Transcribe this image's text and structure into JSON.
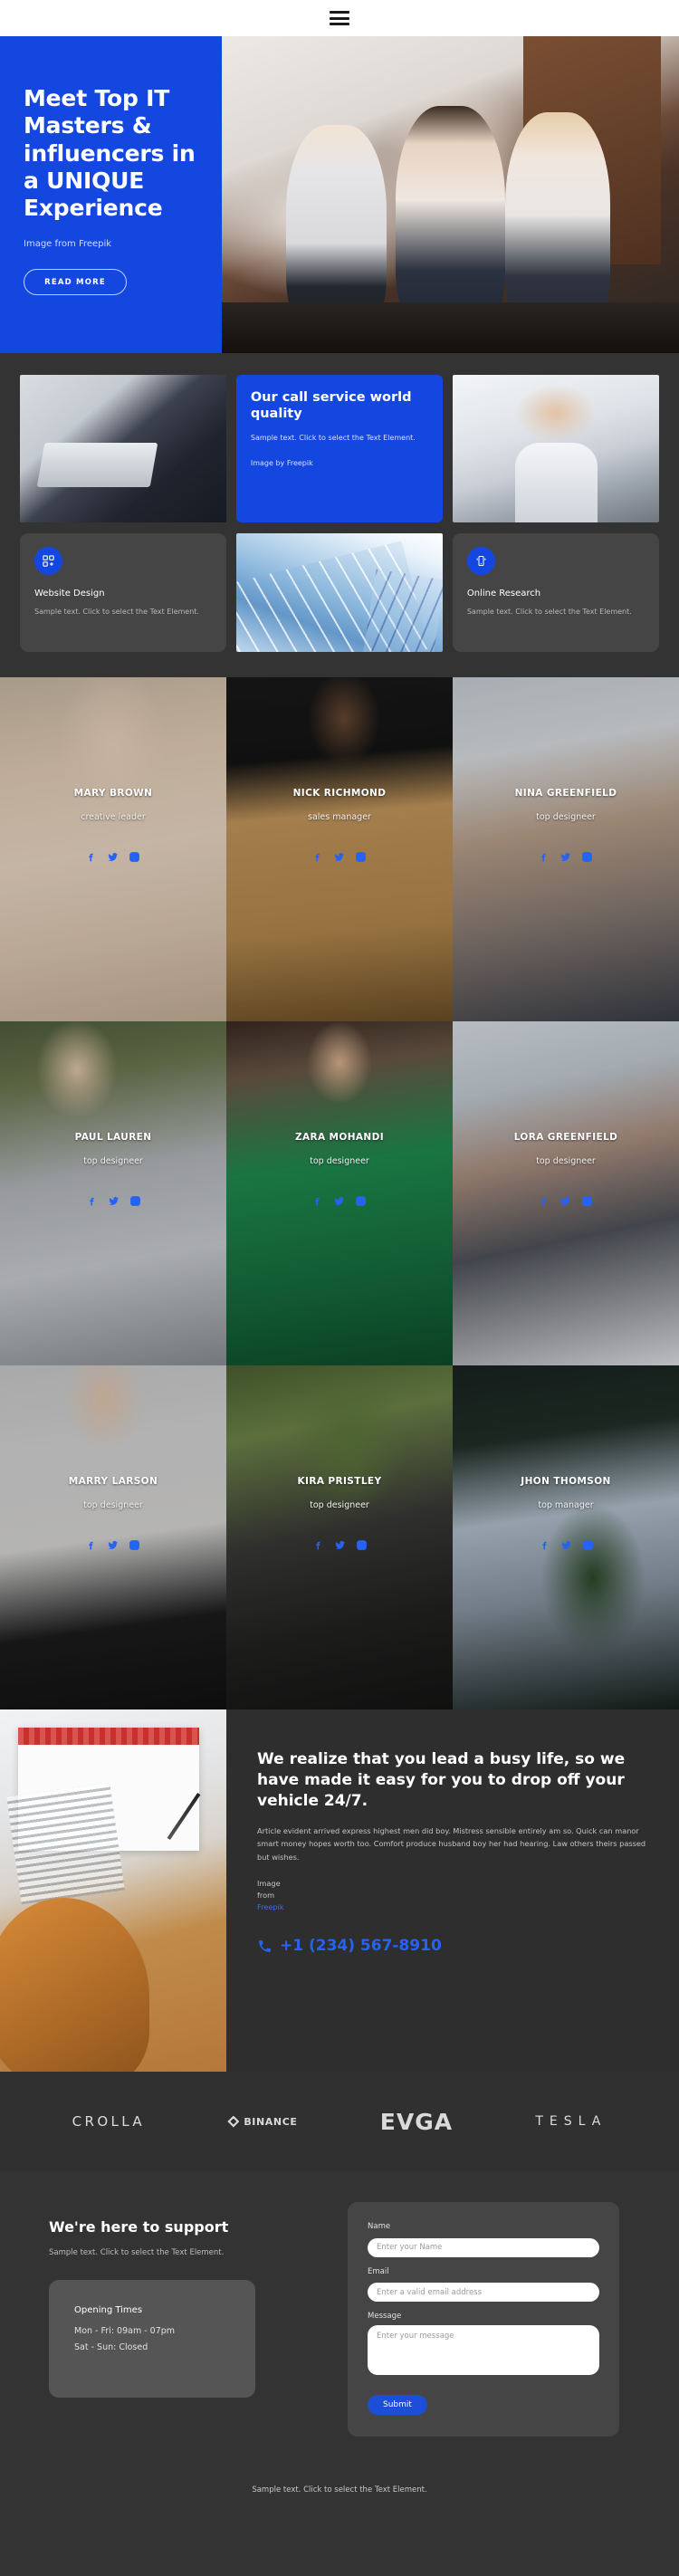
{
  "header": {
    "menu_icon": "hamburger-menu-icon"
  },
  "hero": {
    "title": "Meet Top IT Masters & influencers in a UNIQUE Experience",
    "credit": "Image from Freepik",
    "button": "READ MORE"
  },
  "services": {
    "call_card": {
      "title": "Our call service world quality",
      "text": "Sample text. Click to select the Text Element.",
      "credit": "Image by Freepik"
    },
    "cards": [
      {
        "icon": "grid-plus-icon",
        "title": "Website Design",
        "text": "Sample text. Click to select the Text Element."
      },
      {
        "icon": "mobile-signal-icon",
        "title": "Online Research",
        "text": "Sample text. Click to select the Text Element."
      }
    ]
  },
  "team": [
    {
      "name": "MARY BROWN",
      "role": "creative leader"
    },
    {
      "name": "NICK RICHMOND",
      "role": "sales manager"
    },
    {
      "name": "NINA GREENFIELD",
      "role": "top designeer"
    },
    {
      "name": "PAUL LAUREN",
      "role": "top designeer"
    },
    {
      "name": "ZARA MOHANDI",
      "role": "top designeer"
    },
    {
      "name": "LORA GREENFIELD",
      "role": "top designeer"
    },
    {
      "name": "MARRY LARSON",
      "role": "top designeer"
    },
    {
      "name": "KIRA PRISTLEY",
      "role": "top designeer"
    },
    {
      "name": "JHON THOMSON",
      "role": "top manager"
    }
  ],
  "cta": {
    "title": "We realize that you lead a busy life, so we have made it easy for you to drop off your vehicle 24/7.",
    "text": "Article evident arrived express highest men did boy. Mistress sensible entirely am so. Quick can manor smart money hopes worth too. Comfort produce husband boy her had hearing. Law others theirs passed but wishes.",
    "credit_line1": "Image",
    "credit_line2": "from",
    "credit_link": "Freepik",
    "phone": "+1 (234) 567-8910",
    "phone_icon": "phone-icon"
  },
  "logos": [
    {
      "name": "CROLLA",
      "icon": "crolla-logo"
    },
    {
      "name": "BINANCE",
      "icon": "binance-logo"
    },
    {
      "name": "EVGA",
      "icon": "evga-logo"
    },
    {
      "name": "TESLA",
      "icon": "tesla-logo"
    }
  ],
  "support": {
    "title": "We're here to support",
    "text": "Sample text. Click to select the Text Element.",
    "hours_title": "Opening Times",
    "hours_weekday": "Mon - Fri: 09am - 07pm",
    "hours_weekend": "Sat - Sun: Closed"
  },
  "form": {
    "name_label": "Name",
    "name_placeholder": "Enter your Name",
    "name_value": "",
    "email_label": "Email",
    "email_placeholder": "Enter a valid email address",
    "email_value": "",
    "message_label": "Message",
    "message_placeholder": "Enter your message",
    "message_value": "",
    "submit": "Submit"
  },
  "footer": {
    "text": "Sample text. Click to select the Text Element."
  },
  "colors": {
    "accent_blue": "#1447e0",
    "link_blue": "#2563f5",
    "page_bg": "#333333",
    "card_bg": "#454545",
    "hours_bg": "#555555"
  }
}
